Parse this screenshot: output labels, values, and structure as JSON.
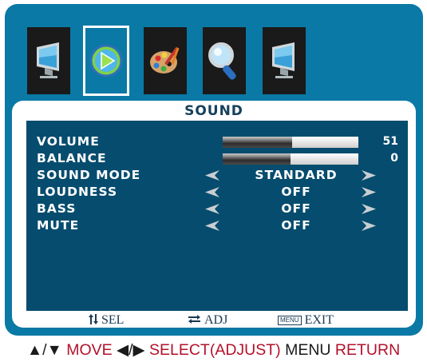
{
  "tabs": [
    {
      "icon": "monitor-icon",
      "selected": false
    },
    {
      "icon": "play-icon",
      "selected": true
    },
    {
      "icon": "palette-icon",
      "selected": false
    },
    {
      "icon": "magnifier-icon",
      "selected": false
    },
    {
      "icon": "monitor-icon",
      "selected": false
    }
  ],
  "panel": {
    "title": "SOUND",
    "rows": {
      "volume": {
        "label": "VOLUME",
        "value": "51",
        "level_percent": 51
      },
      "balance": {
        "label": "BALANCE",
        "value": "0",
        "level_percent": 50
      },
      "sound_mode": {
        "label": "SOUND MODE",
        "value": "STANDARD"
      },
      "loudness": {
        "label": "LOUDNESS",
        "value": "OFF"
      },
      "bass": {
        "label": "BASS",
        "value": "OFF"
      },
      "mute": {
        "label": "MUTE",
        "value": "OFF"
      }
    }
  },
  "footer": {
    "sel_icon": "up-down-arrows-icon",
    "sel_label": "SEL",
    "adj_icon": "left-right-arrows-icon",
    "adj_label": "ADJ",
    "menu_key": "MENU",
    "exit_label": "EXIT"
  },
  "legend": {
    "up_down": "▲/▼",
    "move": "MOVE",
    "left_right": "◀/▶",
    "select": "SELECT(ADJUST)",
    "menu": "MENU",
    "return": "RETURN"
  },
  "colors": {
    "osd_background": "#0a79a5",
    "panel_background": "#ffffff",
    "inner_background": "#064c6e",
    "title_text": "#16405c",
    "legend_red": "#b3112a",
    "tab_selected_border": "#ffffff"
  }
}
